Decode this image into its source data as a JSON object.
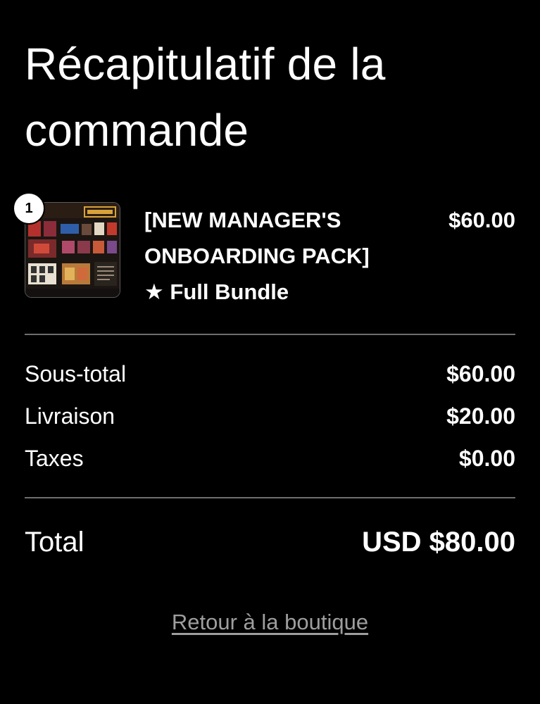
{
  "summary": {
    "title": "Récapitulatif de la commande"
  },
  "item": {
    "quantity": "1",
    "name": "[NEW MANAGER'S ONBOARDING PACK]",
    "variant": "★ Full Bundle",
    "price": "$60.00"
  },
  "totals": {
    "subtotal_label": "Sous-total",
    "subtotal_value": "$60.00",
    "shipping_label": "Livraison",
    "shipping_value": "$20.00",
    "taxes_label": "Taxes",
    "taxes_value": "$0.00",
    "total_label": "Total",
    "total_value": "USD $80.00"
  },
  "footer": {
    "back_link": "Retour à la boutique"
  },
  "colors": {
    "background": "#000000",
    "text": "#ffffff",
    "divider": "#6e6e6e",
    "link": "#9e9e9e"
  }
}
